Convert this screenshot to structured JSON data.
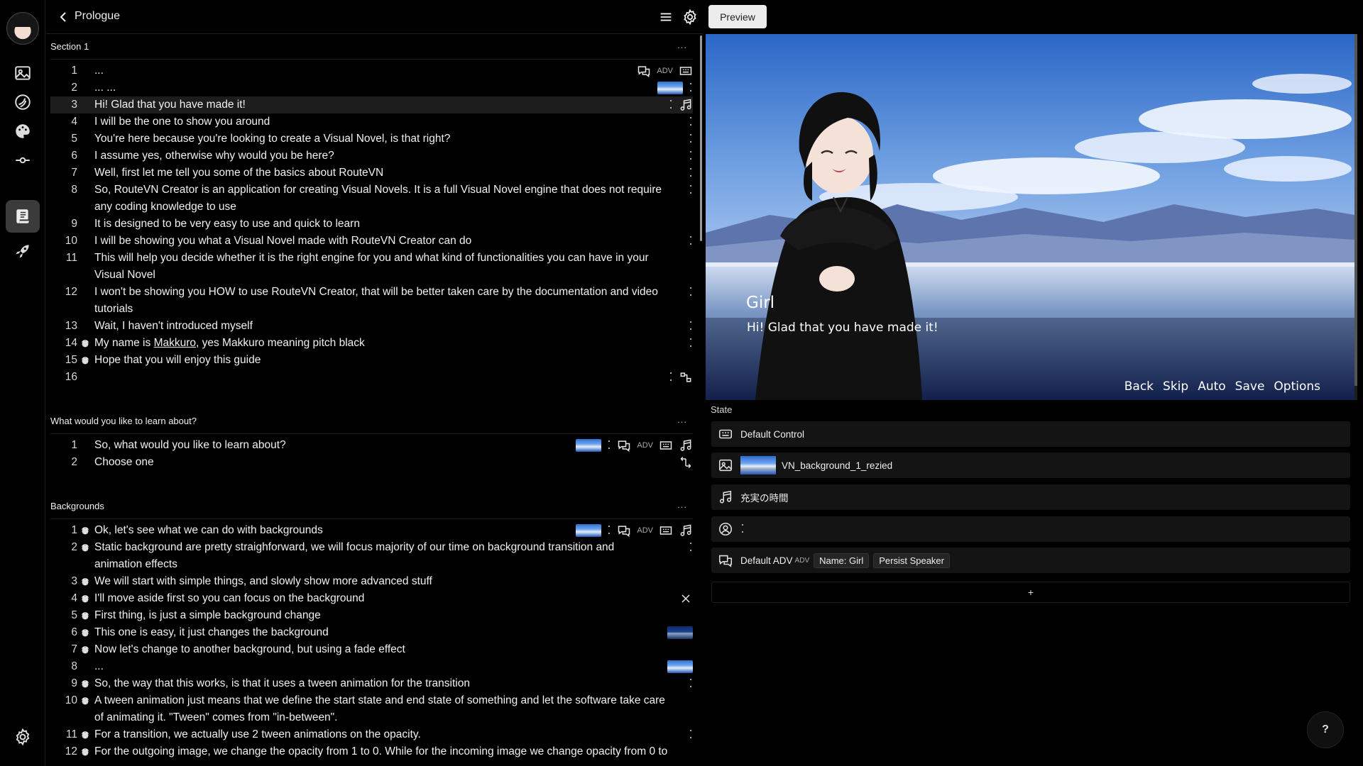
{
  "nav": {
    "items": [
      "image-icon",
      "palette-icon",
      "theme-icon",
      "transition-icon",
      "script-icon",
      "rocket-icon"
    ],
    "active": "script-icon",
    "settings": "gear-icon"
  },
  "script": {
    "title": "Prologue",
    "sections": [
      {
        "name": "Section 1",
        "more": "...",
        "lines": [
          {
            "num": "1",
            "text": "..."
          },
          {
            "num": "2",
            "text": "... ..."
          },
          {
            "num": "3",
            "text": "Hi! Glad that you have made it!"
          },
          {
            "num": "4",
            "text": "I will be the one to show you around"
          },
          {
            "num": "5",
            "text": "You're here because you're looking to create a Visual Novel, is that right?"
          },
          {
            "num": "6",
            "text": "I assume yes, otherwise why would you be here?"
          },
          {
            "num": "7",
            "text": "Well, first let me tell you some of the basics about RouteVN"
          },
          {
            "num": "8",
            "text": "So, RouteVN Creator is an application for creating Visual Novels. It is a full Visual Novel engine that does not require\nany coding knowledge to use"
          },
          {
            "num": "9",
            "text": "It is designed to be very easy to use and quick to learn"
          },
          {
            "num": "10",
            "text": "I will be showing you what a Visual Novel made with RouteVN Creator can do"
          },
          {
            "num": "11",
            "text": "This will help you decide whether it is the right engine for you and what kind of functionalities you can have in your\nVisual Novel"
          },
          {
            "num": "12",
            "text": "I won't be showing you HOW to use RouteVN Creator, that will be better taken care by the documentation and video\ntutorials"
          },
          {
            "num": "13",
            "text": "Wait, I haven't introduced myself"
          },
          {
            "num": "14",
            "text_a": "My name is ",
            "text_b": "Makkuro",
            "text_c": ", yes Makkuro meaning pitch black"
          },
          {
            "num": "15",
            "text": "Hope that you will enjoy this guide"
          },
          {
            "num": "16",
            "text": ""
          }
        ],
        "adv": "ADV"
      },
      {
        "name": "What would you like to learn about?",
        "more": "...",
        "lines": [
          {
            "num": "1",
            "text": "So, what would you like to learn about?"
          },
          {
            "num": "2",
            "text": "Choose one"
          }
        ],
        "adv": "ADV"
      },
      {
        "name": "Backgrounds",
        "more": "...",
        "lines": [
          {
            "num": "1",
            "text": "Ok, let's see what we can do with backgrounds"
          },
          {
            "num": "2",
            "text": "Static background are pretty straighforward, we will focus majority of our time on background transition and\nanimation effects"
          },
          {
            "num": "3",
            "text": "We will start with simple things, and slowly show more advanced stuff"
          },
          {
            "num": "4",
            "text": "I'll move aside first so you can focus on the background"
          },
          {
            "num": "5",
            "text": "First thing, is just a simple background change"
          },
          {
            "num": "6",
            "text": "This one is easy, it just changes the background"
          },
          {
            "num": "7",
            "text": "Now let's change to another background, but using a fade effect"
          },
          {
            "num": "8",
            "text": "..."
          },
          {
            "num": "9",
            "text": "So, the way that this works, is that it uses a tween animation for the transition"
          },
          {
            "num": "10",
            "text": "A tween animation just means that we define the start state and end state of something and let the software take care\nof animating it. \"Tween\" comes from \"in-between\"."
          },
          {
            "num": "11",
            "text": "For a transition, we actually use 2 tween animations on the opacity."
          },
          {
            "num": "12",
            "text": "For the outgoing image, we change the opacity from 1 to 0. While for the incoming image we change opacity from 0 to"
          }
        ],
        "adv": "ADV"
      }
    ]
  },
  "preview": {
    "button": "Preview",
    "speaker": "Girl",
    "dialogue": "Hi! Glad that you have made it!",
    "controls": [
      "Back",
      "Skip",
      "Auto",
      "Save",
      "Options"
    ]
  },
  "state": {
    "label": "State",
    "control": "Default Control",
    "background": "VN_background_1_rezied",
    "music": "充実の時間",
    "dialogue_layout": "Default ADV",
    "dialogue_adv": "ADV",
    "name_chip": "Name: Girl",
    "persist_chip": "Persist Speaker",
    "add": "+"
  },
  "help": "?"
}
